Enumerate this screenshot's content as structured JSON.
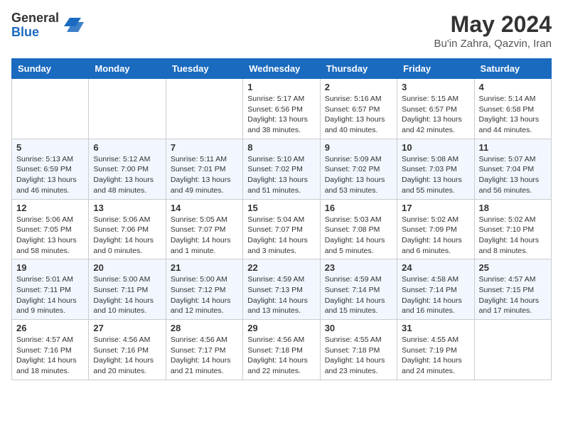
{
  "header": {
    "logo_general": "General",
    "logo_blue": "Blue",
    "month_year": "May 2024",
    "location": "Bu'in Zahra, Qazvin, Iran"
  },
  "days_of_week": [
    "Sunday",
    "Monday",
    "Tuesday",
    "Wednesday",
    "Thursday",
    "Friday",
    "Saturday"
  ],
  "weeks": [
    [
      {
        "day": null,
        "info": null
      },
      {
        "day": null,
        "info": null
      },
      {
        "day": null,
        "info": null
      },
      {
        "day": "1",
        "info": "Sunrise: 5:17 AM\nSunset: 6:56 PM\nDaylight: 13 hours\nand 38 minutes."
      },
      {
        "day": "2",
        "info": "Sunrise: 5:16 AM\nSunset: 6:57 PM\nDaylight: 13 hours\nand 40 minutes."
      },
      {
        "day": "3",
        "info": "Sunrise: 5:15 AM\nSunset: 6:57 PM\nDaylight: 13 hours\nand 42 minutes."
      },
      {
        "day": "4",
        "info": "Sunrise: 5:14 AM\nSunset: 6:58 PM\nDaylight: 13 hours\nand 44 minutes."
      }
    ],
    [
      {
        "day": "5",
        "info": "Sunrise: 5:13 AM\nSunset: 6:59 PM\nDaylight: 13 hours\nand 46 minutes."
      },
      {
        "day": "6",
        "info": "Sunrise: 5:12 AM\nSunset: 7:00 PM\nDaylight: 13 hours\nand 48 minutes."
      },
      {
        "day": "7",
        "info": "Sunrise: 5:11 AM\nSunset: 7:01 PM\nDaylight: 13 hours\nand 49 minutes."
      },
      {
        "day": "8",
        "info": "Sunrise: 5:10 AM\nSunset: 7:02 PM\nDaylight: 13 hours\nand 51 minutes."
      },
      {
        "day": "9",
        "info": "Sunrise: 5:09 AM\nSunset: 7:02 PM\nDaylight: 13 hours\nand 53 minutes."
      },
      {
        "day": "10",
        "info": "Sunrise: 5:08 AM\nSunset: 7:03 PM\nDaylight: 13 hours\nand 55 minutes."
      },
      {
        "day": "11",
        "info": "Sunrise: 5:07 AM\nSunset: 7:04 PM\nDaylight: 13 hours\nand 56 minutes."
      }
    ],
    [
      {
        "day": "12",
        "info": "Sunrise: 5:06 AM\nSunset: 7:05 PM\nDaylight: 13 hours\nand 58 minutes."
      },
      {
        "day": "13",
        "info": "Sunrise: 5:06 AM\nSunset: 7:06 PM\nDaylight: 14 hours\nand 0 minutes."
      },
      {
        "day": "14",
        "info": "Sunrise: 5:05 AM\nSunset: 7:07 PM\nDaylight: 14 hours\nand 1 minute."
      },
      {
        "day": "15",
        "info": "Sunrise: 5:04 AM\nSunset: 7:07 PM\nDaylight: 14 hours\nand 3 minutes."
      },
      {
        "day": "16",
        "info": "Sunrise: 5:03 AM\nSunset: 7:08 PM\nDaylight: 14 hours\nand 5 minutes."
      },
      {
        "day": "17",
        "info": "Sunrise: 5:02 AM\nSunset: 7:09 PM\nDaylight: 14 hours\nand 6 minutes."
      },
      {
        "day": "18",
        "info": "Sunrise: 5:02 AM\nSunset: 7:10 PM\nDaylight: 14 hours\nand 8 minutes."
      }
    ],
    [
      {
        "day": "19",
        "info": "Sunrise: 5:01 AM\nSunset: 7:11 PM\nDaylight: 14 hours\nand 9 minutes."
      },
      {
        "day": "20",
        "info": "Sunrise: 5:00 AM\nSunset: 7:11 PM\nDaylight: 14 hours\nand 10 minutes."
      },
      {
        "day": "21",
        "info": "Sunrise: 5:00 AM\nSunset: 7:12 PM\nDaylight: 14 hours\nand 12 minutes."
      },
      {
        "day": "22",
        "info": "Sunrise: 4:59 AM\nSunset: 7:13 PM\nDaylight: 14 hours\nand 13 minutes."
      },
      {
        "day": "23",
        "info": "Sunrise: 4:59 AM\nSunset: 7:14 PM\nDaylight: 14 hours\nand 15 minutes."
      },
      {
        "day": "24",
        "info": "Sunrise: 4:58 AM\nSunset: 7:14 PM\nDaylight: 14 hours\nand 16 minutes."
      },
      {
        "day": "25",
        "info": "Sunrise: 4:57 AM\nSunset: 7:15 PM\nDaylight: 14 hours\nand 17 minutes."
      }
    ],
    [
      {
        "day": "26",
        "info": "Sunrise: 4:57 AM\nSunset: 7:16 PM\nDaylight: 14 hours\nand 18 minutes."
      },
      {
        "day": "27",
        "info": "Sunrise: 4:56 AM\nSunset: 7:16 PM\nDaylight: 14 hours\nand 20 minutes."
      },
      {
        "day": "28",
        "info": "Sunrise: 4:56 AM\nSunset: 7:17 PM\nDaylight: 14 hours\nand 21 minutes."
      },
      {
        "day": "29",
        "info": "Sunrise: 4:56 AM\nSunset: 7:18 PM\nDaylight: 14 hours\nand 22 minutes."
      },
      {
        "day": "30",
        "info": "Sunrise: 4:55 AM\nSunset: 7:18 PM\nDaylight: 14 hours\nand 23 minutes."
      },
      {
        "day": "31",
        "info": "Sunrise: 4:55 AM\nSunset: 7:19 PM\nDaylight: 14 hours\nand 24 minutes."
      },
      {
        "day": null,
        "info": null
      }
    ]
  ]
}
